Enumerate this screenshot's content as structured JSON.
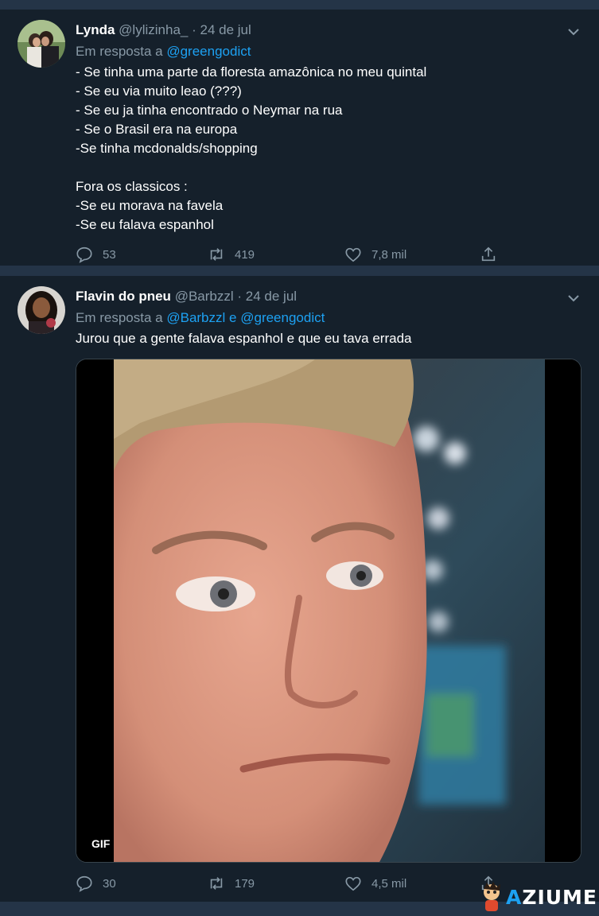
{
  "tweets": [
    {
      "name": "Lynda",
      "handle": "@lylizinha_",
      "sep": "·",
      "date": "24 de jul",
      "reply_prefix": "Em resposta a",
      "reply_to": "@greengodict",
      "text": "- Se tinha uma parte da floresta amazônica no meu quintal\n- Se eu via muito leao (???)\n- Se eu ja tinha encontrado o Neymar na rua\n- Se o Brasil era na europa\n-Se tinha mcdonalds/shopping\n\nFora os classicos :\n-Se eu morava na favela\n-Se eu falava espanhol",
      "replies": "53",
      "retweets": "419",
      "likes": "7,8 mil"
    },
    {
      "name": "Flavin do pneu",
      "handle": "@Barbzzl",
      "sep": "·",
      "date": "24 de jul",
      "reply_prefix": "Em resposta a",
      "reply_to": "@Barbzzl",
      "reply_joiner": "e",
      "reply_to_2": "@greengodict",
      "text": "Jurou que a gente falava espanhol e que eu tava errada",
      "media_badge": "GIF",
      "replies": "30",
      "retweets": "179",
      "likes": "4,5 mil"
    }
  ],
  "watermark": {
    "text": "AZIUME",
    "accent_letter": "A"
  },
  "colors": {
    "background": "#15202b",
    "separator": "#243447",
    "link": "#1da1f2",
    "muted": "#8899a6"
  },
  "icons": [
    "chevron-down-icon",
    "reply-icon",
    "retweet-icon",
    "like-icon",
    "share-icon"
  ]
}
